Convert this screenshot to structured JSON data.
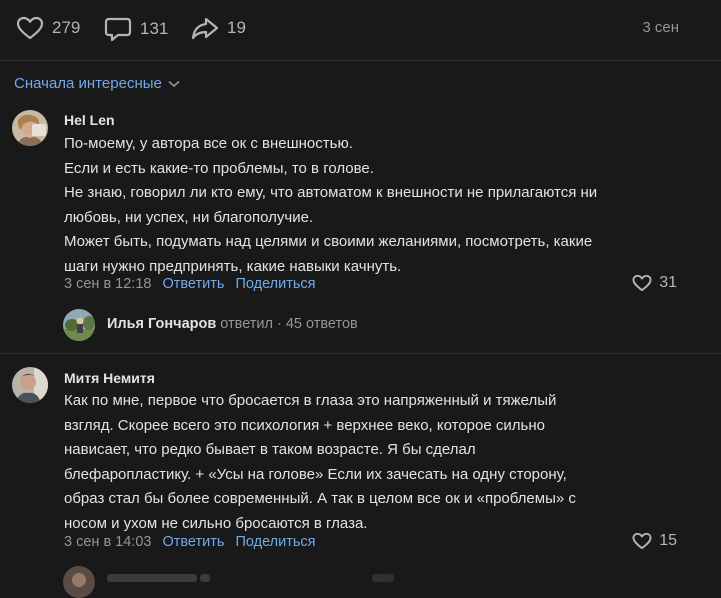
{
  "post_stats": {
    "likes": "279",
    "comments": "131",
    "shares": "19",
    "date": "3 сен"
  },
  "sort": {
    "label": "Сначала интересные"
  },
  "comments": [
    {
      "author": "Hel Len",
      "lines": [
        "По-моему, у автора все ок с внешностью.",
        "Если и есть какие-то проблемы, то в голове.",
        "Не знаю, говорил ли кто ему, что автоматом к внешности не прилагаются ни",
        "любовь, ни успех, ни благополучие.",
        "Может быть, подумать над целями и своими желаниями, посмотреть, какие",
        "шаги нужно предпринять, какие навыки качнуть."
      ],
      "time": "3 сен в 12:18",
      "reply": "Ответить",
      "share": "Поделиться",
      "likes": "31",
      "thread": {
        "author": "Илья Гончаров",
        "action": "ответил",
        "dot": "·",
        "count": "45 ответов"
      }
    },
    {
      "author": "Митя Немитя",
      "lines": [
        "Как по мне, первое что бросается в глаза это напряженный и тяжелый",
        "взгляд. Скорее всего это психология + верхнее веко, которое сильно",
        "нависает, что редко бывает в таком возрасте. Я бы сделал",
        "блефаропластику. + «Усы на голове» Если их зачесать на одну сторону,",
        "образ стал бы более современный. А так в целом все ок и «проблемы» с",
        "носом и ухом не сильно бросаются в глаза."
      ],
      "time": "3 сен в 14:03",
      "reply": "Ответить",
      "share": "Поделиться",
      "likes": "15"
    }
  ]
}
